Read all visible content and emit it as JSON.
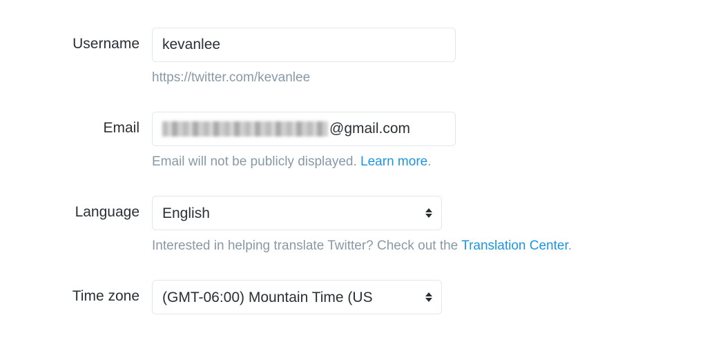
{
  "form": {
    "username": {
      "label": "Username",
      "value": "kevanlee",
      "url_help": "https://twitter.com/kevanlee"
    },
    "email": {
      "label": "Email",
      "domain_suffix": "@gmail.com",
      "help_text": "Email will not be publicly displayed. ",
      "learn_more": "Learn more",
      "help_period": "."
    },
    "language": {
      "label": "Language",
      "value": "English",
      "help_text": "Interested in helping translate Twitter? Check out the ",
      "translation_link": "Translation Center",
      "help_period": "."
    },
    "timezone": {
      "label": "Time zone",
      "value": "(GMT-06:00) Mountain Time (US"
    }
  }
}
